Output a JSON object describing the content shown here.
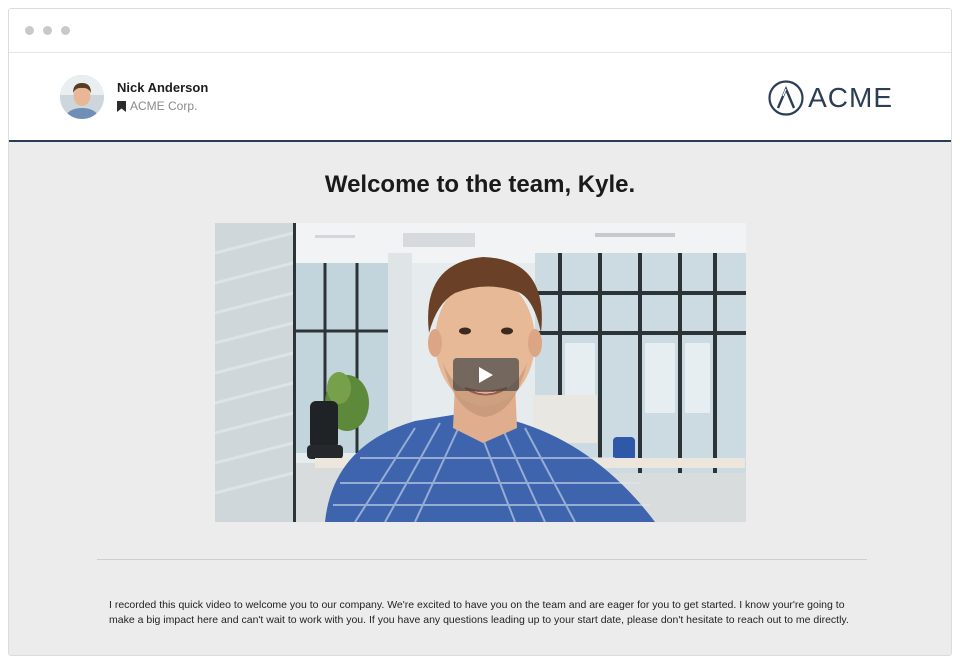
{
  "window": {
    "dots": [
      "window-dot-1",
      "window-dot-2",
      "window-dot-3"
    ]
  },
  "sender": {
    "name": "Nick Anderson",
    "company": "ACME Corp."
  },
  "brand": {
    "logo_text": "ACME",
    "color": "#2c3e55"
  },
  "main": {
    "title": "Welcome to the team, Kyle.",
    "message": "I recorded this quick video to welcome you to our company. We're excited to have you on the team and are eager for you to get started. I know your're going to make a big impact here and can't wait to work with you. If you have any questions leading up to your start date, please don't hesitate to reach out to me directly."
  },
  "video": {
    "icon": "play-icon"
  }
}
